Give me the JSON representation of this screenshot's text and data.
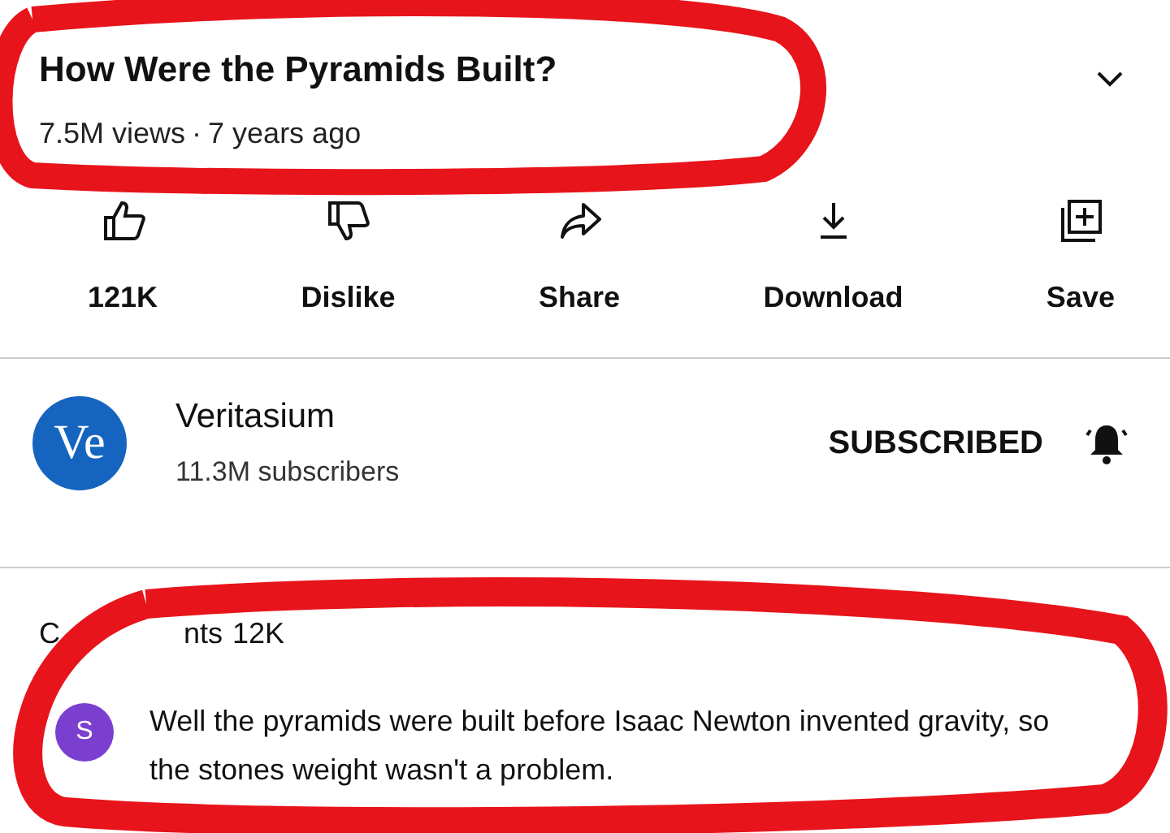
{
  "video": {
    "title": "How Were the Pyramids Built?",
    "views": "7.5M views",
    "separator": "·",
    "age": "7 years ago"
  },
  "actions": [
    {
      "kind": "like",
      "label": "121K"
    },
    {
      "kind": "dislike",
      "label": "Dislike"
    },
    {
      "kind": "share",
      "label": "Share"
    },
    {
      "kind": "download",
      "label": "Download"
    },
    {
      "kind": "save",
      "label": "Save"
    }
  ],
  "channel": {
    "logo": "Ve",
    "name": "Veritasium",
    "subscribers": "11.3M subscribers",
    "subscribe_label": "SUBSCRIBED"
  },
  "comments": {
    "header_start": "C",
    "header_end": "nts",
    "count": "12K",
    "avatar": "S",
    "text": "Well the pyramids were built before Isaac Newton invented gravity, so the stones weight wasn't a problem."
  }
}
